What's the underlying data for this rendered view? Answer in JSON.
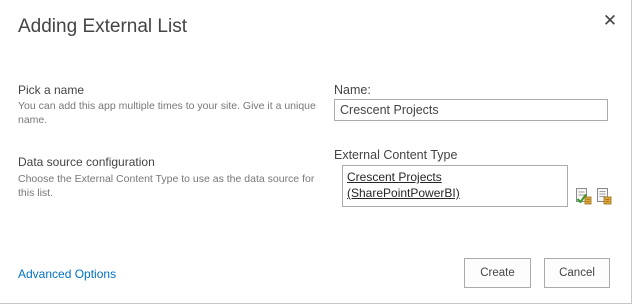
{
  "dialog": {
    "title": "Adding External List",
    "close_glyph": "✕"
  },
  "name_section": {
    "heading": "Pick a name",
    "description": "You can add this app multiple times to your site. Give it a unique name.",
    "field_label": "Name:",
    "field_value": "Crescent Projects"
  },
  "source_section": {
    "heading": "Data source configuration",
    "description": "Choose the External Content Type to use as the data source for this list.",
    "field_label": "External Content Type",
    "selected_line1": "Crescent Projects",
    "selected_line2": "(SharePointPowerBI)",
    "icons": [
      "check-names-icon",
      "browse-content-types-icon"
    ]
  },
  "footer": {
    "advanced_link": "Advanced Options",
    "create_label": "Create",
    "cancel_label": "Cancel"
  }
}
